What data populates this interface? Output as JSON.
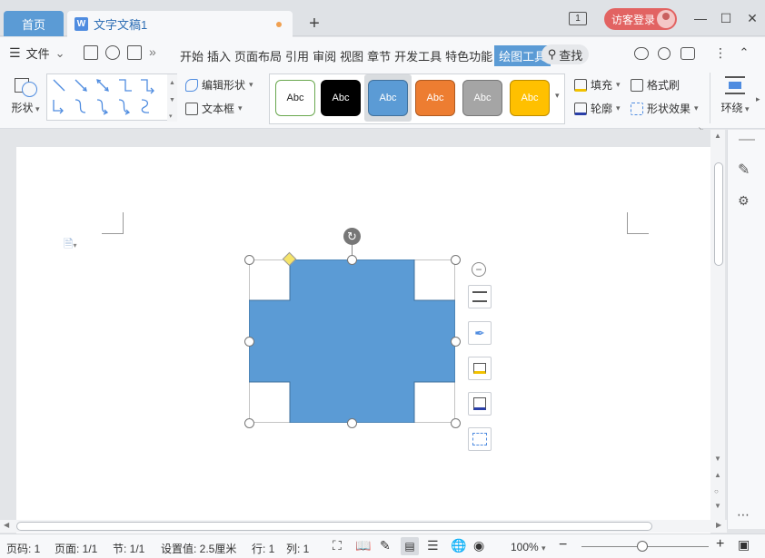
{
  "tabs": {
    "home": "首页",
    "document": "文字文稿1",
    "document_icon": "W"
  },
  "titlebar": {
    "window_count": "1",
    "login": "访客登录"
  },
  "menu": {
    "file": "文件",
    "items": [
      "开始",
      "插入",
      "页面布局",
      "引用",
      "审阅",
      "视图",
      "章节",
      "开发工具",
      "特色功能",
      "绘图工具"
    ],
    "active": "绘图工具",
    "search": "查找"
  },
  "ribbon": {
    "shapes": "形状",
    "edit_shape": "编辑形状",
    "text_box": "文本框",
    "styles": [
      {
        "label": "Abc",
        "bg": "#ffffff",
        "fg": "#222222",
        "border": "#6aa84f"
      },
      {
        "label": "Abc",
        "bg": "#000000",
        "fg": "#ffffff",
        "border": "#000000"
      },
      {
        "label": "Abc",
        "bg": "#5b9bd5",
        "fg": "#ffffff",
        "border": "#41719c"
      },
      {
        "label": "Abc",
        "bg": "#ed7d31",
        "fg": "#ffffff",
        "border": "#ae5a21"
      },
      {
        "label": "Abc",
        "bg": "#a5a5a5",
        "fg": "#ffffff",
        "border": "#787878"
      },
      {
        "label": "Abc",
        "bg": "#ffc000",
        "fg": "#ffffff",
        "border": "#bc8c00"
      }
    ],
    "fill": "填充",
    "format_painter": "格式刷",
    "outline": "轮廓",
    "shape_effects": "形状效果",
    "wrap": "环绕"
  },
  "colors": {
    "accent": "#5b9bd5",
    "login_bg": "#e26362",
    "shape_fill": "#5b9bd5"
  },
  "status": {
    "page": "页码: 1",
    "pages": "页面: 1/1",
    "section": "节: 1/1",
    "setting": "设置值: 2.5厘米",
    "row": "行: 1",
    "col": "列: 1",
    "zoom": "100%"
  }
}
